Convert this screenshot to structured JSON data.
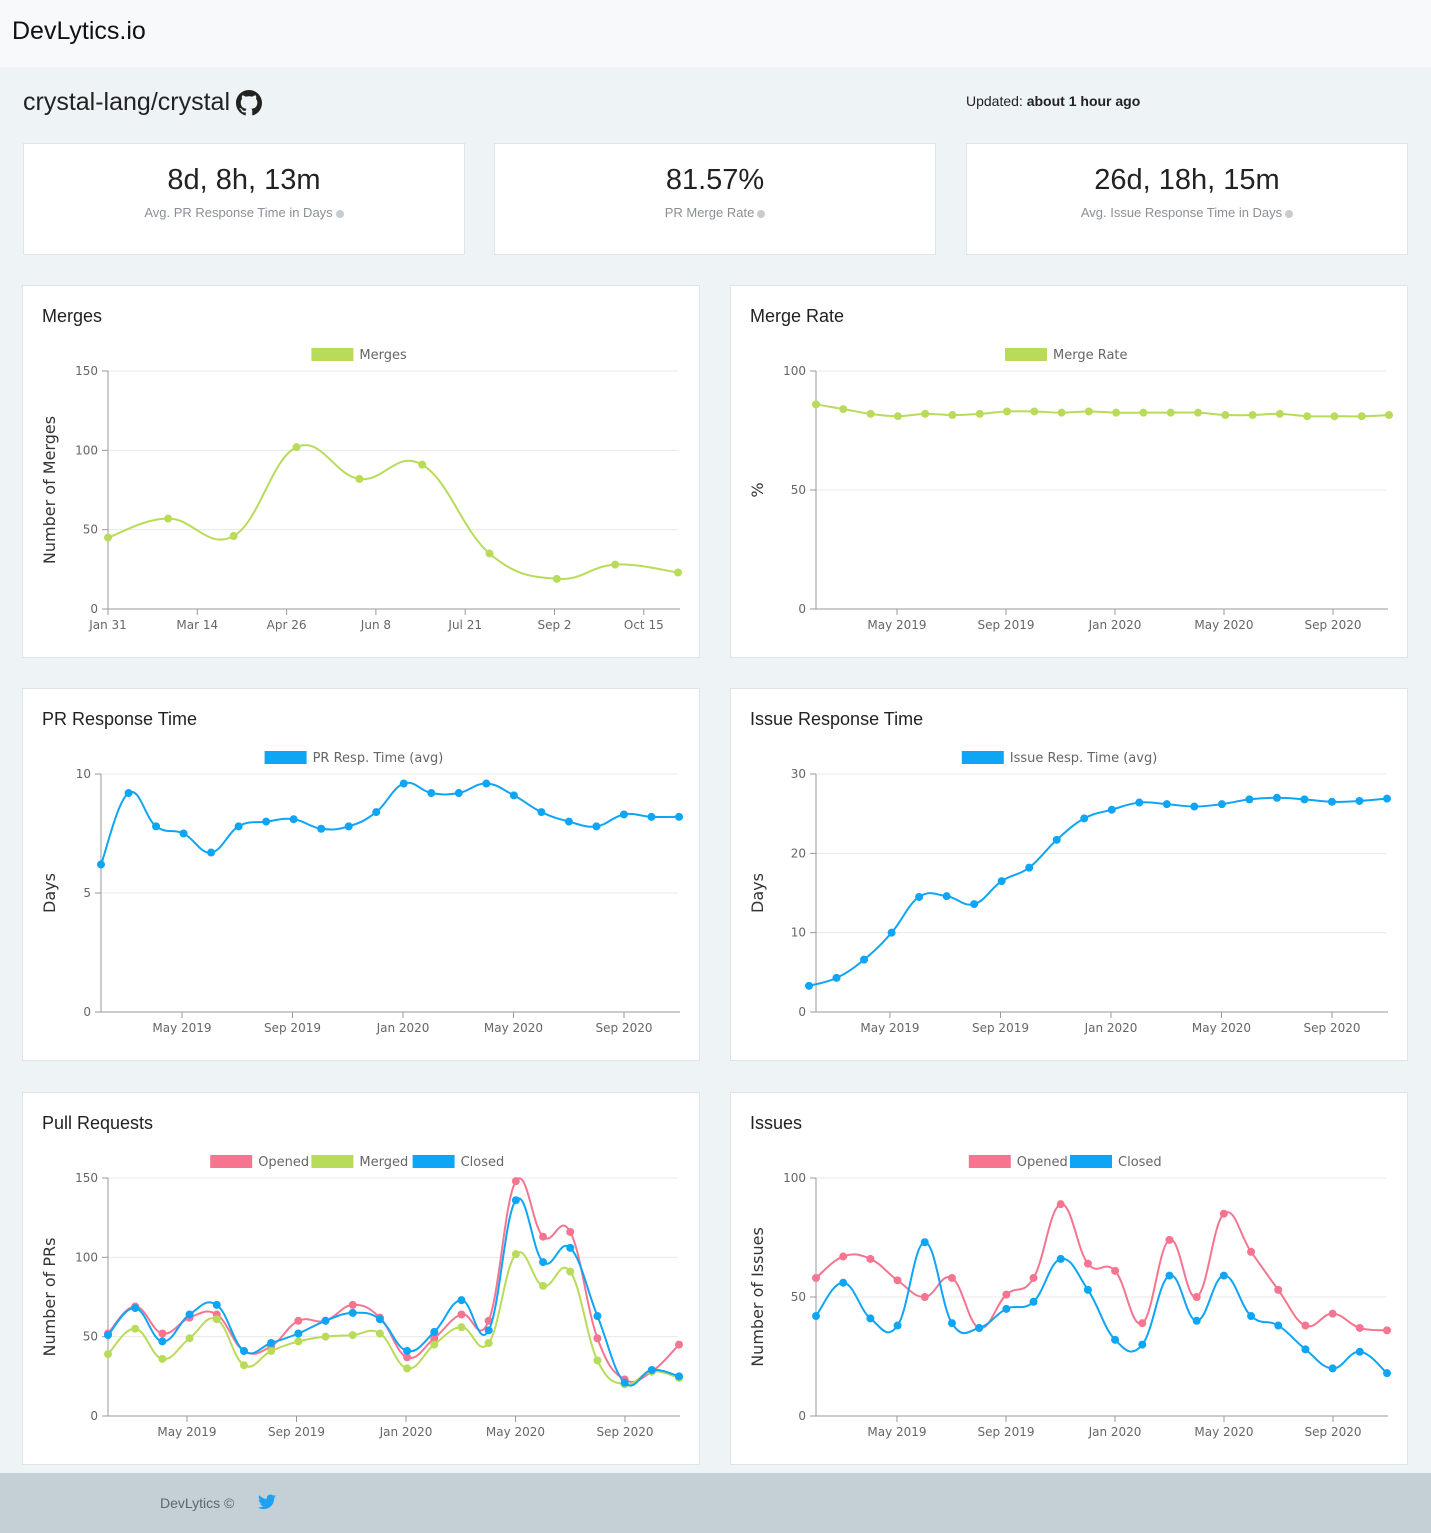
{
  "brand": "DevLytics.io",
  "repo": {
    "name": "crystal-lang/crystal",
    "icon": "github-icon"
  },
  "updated": {
    "label": "Updated:",
    "value": "about 1 hour ago"
  },
  "stats": [
    {
      "value": "8d, 8h, 13m",
      "label": "Avg. PR Response Time in Days"
    },
    {
      "value": "81.57%",
      "label": "PR Merge Rate"
    },
    {
      "value": "26d, 18h, 15m",
      "label": "Avg. Issue Response Time in Days"
    }
  ],
  "colors": {
    "green": "#b8dc59",
    "blue": "#0ea5f5",
    "pink": "#f57590",
    "grid": "#e8e8e8",
    "axis": "#999999"
  },
  "charts": {
    "merges": {
      "title": "Merges"
    },
    "merge_rate": {
      "title": "Merge Rate"
    },
    "pr_response": {
      "title": "PR Response Time"
    },
    "issue_response": {
      "title": "Issue Response Time"
    },
    "pull_requests": {
      "title": "Pull Requests"
    },
    "issues": {
      "title": "Issues"
    }
  },
  "chart_data": [
    {
      "id": "merges",
      "type": "line",
      "title": "Merges",
      "xlabel": "",
      "ylabel": "Number of Merges",
      "ylim": [
        0,
        150
      ],
      "yticks": [
        0,
        50,
        100,
        150
      ],
      "xticks": [
        "Jan 31",
        "Mar 14",
        "Apr 26",
        "Jun 8",
        "Jul 21",
        "Sep 2",
        "Oct 15"
      ],
      "x": [
        0,
        0.5,
        1.05,
        1.47,
        2.0,
        2.5,
        2.87,
        3.3,
        4.25,
        4.65,
        5.0
      ],
      "legend": "top",
      "series": [
        {
          "name": "Merges",
          "color": "green",
          "values": [
            45,
            57,
            46,
            102,
            82,
            91,
            35,
            19,
            28,
            23
          ]
        }
      ],
      "points_x": [
        0,
        0.67,
        1.4,
        2.1,
        2.8,
        3.5,
        4.25,
        5.0,
        5.65,
        6.35
      ]
    },
    {
      "id": "merge_rate",
      "type": "line",
      "title": "Merge Rate",
      "xlabel": "",
      "ylabel": "%",
      "ylim": [
        0,
        100
      ],
      "yticks": [
        0,
        50,
        100
      ],
      "xticks": [
        "May 2019",
        "Sep 2019",
        "Jan 2020",
        "May 2020",
        "Sep 2020"
      ],
      "legend": "top",
      "series": [
        {
          "name": "Merge Rate",
          "color": "green",
          "values": [
            86,
            84,
            82,
            81,
            82,
            81.5,
            82,
            83,
            83,
            82.5,
            83,
            82.5,
            82.5,
            82.5,
            82.5,
            81.5,
            81.5,
            82,
            81,
            81,
            81,
            81.5
          ]
        }
      ]
    },
    {
      "id": "pr_response",
      "type": "line",
      "title": "PR Response Time",
      "xlabel": "",
      "ylabel": "Days",
      "ylim": [
        0,
        10
      ],
      "yticks": [
        0,
        5,
        10
      ],
      "xticks": [
        "May 2019",
        "Sep 2019",
        "Jan 2020",
        "May 2020",
        "Sep 2020"
      ],
      "legend": "top",
      "series": [
        {
          "name": "PR Resp. Time (avg)",
          "color": "blue",
          "values": [
            6.2,
            9.2,
            7.8,
            7.5,
            6.7,
            7.8,
            8.0,
            8.1,
            7.7,
            7.8,
            8.4,
            9.6,
            9.2,
            9.2,
            9.6,
            9.1,
            8.4,
            8.0,
            7.8,
            8.3,
            8.2,
            8.2
          ]
        }
      ]
    },
    {
      "id": "issue_response",
      "type": "line",
      "title": "Issue Response Time",
      "xlabel": "",
      "ylabel": "Days",
      "ylim": [
        0,
        30
      ],
      "yticks": [
        0,
        10,
        20,
        30
      ],
      "xticks": [
        "May 2019",
        "Sep 2019",
        "Jan 2020",
        "May 2020",
        "Sep 2020"
      ],
      "legend": "top",
      "series": [
        {
          "name": "Issue Resp. Time (avg)",
          "color": "blue",
          "values": [
            3.3,
            4.3,
            6.6,
            10.0,
            14.5,
            14.6,
            13.6,
            16.5,
            18.2,
            21.7,
            24.4,
            25.5,
            26.4,
            26.2,
            25.9,
            26.2,
            26.8,
            27.0,
            26.8,
            26.5,
            26.6,
            26.9
          ]
        }
      ]
    },
    {
      "id": "pull_requests",
      "type": "line",
      "title": "Pull Requests",
      "xlabel": "",
      "ylabel": "Number of PRs",
      "ylim": [
        0,
        150
      ],
      "yticks": [
        0,
        50,
        100,
        150
      ],
      "xticks": [
        "May 2019",
        "Sep 2019",
        "Jan 2020",
        "May 2020",
        "Sep 2020"
      ],
      "legend": "top",
      "series": [
        {
          "name": "Opened",
          "color": "pink",
          "values": [
            52,
            69,
            52,
            62,
            64,
            41,
            44,
            60,
            60,
            70,
            62,
            37,
            49,
            64,
            60,
            148,
            113,
            116,
            49,
            23,
            28,
            45
          ]
        },
        {
          "name": "Merged",
          "color": "green",
          "values": [
            39,
            55,
            36,
            49,
            61,
            32,
            41,
            47,
            50,
            51,
            52,
            30,
            45,
            56,
            46,
            102,
            82,
            91,
            35,
            20,
            28,
            24
          ]
        },
        {
          "name": "Closed",
          "color": "blue",
          "values": [
            51,
            68,
            47,
            64,
            70,
            41,
            46,
            52,
            60,
            65,
            61,
            41,
            53,
            73,
            54,
            136,
            97,
            106,
            63,
            21,
            29,
            25
          ]
        }
      ]
    },
    {
      "id": "issues",
      "type": "line",
      "title": "Issues",
      "xlabel": "",
      "ylabel": "Number of Issues",
      "ylim": [
        0,
        100
      ],
      "yticks": [
        0,
        50,
        100
      ],
      "xticks": [
        "May 2019",
        "Sep 2019",
        "Jan 2020",
        "May 2020",
        "Sep 2020"
      ],
      "legend": "top",
      "series": [
        {
          "name": "Opened",
          "color": "pink",
          "values": [
            58,
            67,
            66,
            57,
            50,
            58,
            37,
            51,
            58,
            89,
            64,
            61,
            39,
            74,
            50,
            85,
            69,
            53,
            38,
            43,
            37,
            36
          ]
        },
        {
          "name": "Closed",
          "color": "blue",
          "values": [
            42,
            56,
            41,
            38,
            73,
            39,
            37,
            45,
            48,
            66,
            53,
            32,
            30,
            59,
            40,
            59,
            42,
            38,
            28,
            20,
            27,
            18
          ]
        }
      ]
    }
  ],
  "footer": {
    "text": "DevLytics ©",
    "icon": "twitter-icon"
  }
}
